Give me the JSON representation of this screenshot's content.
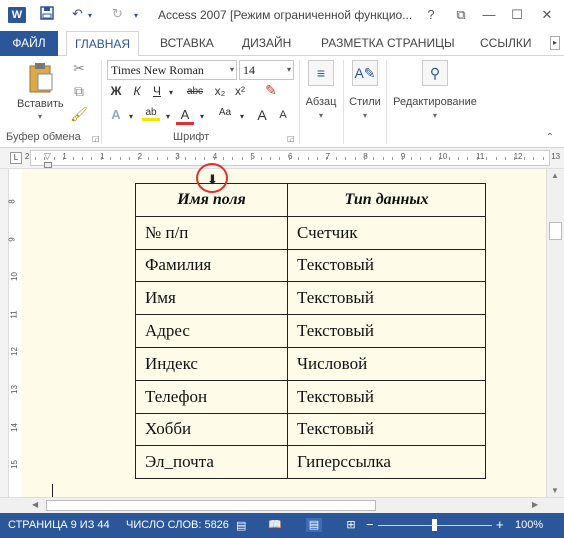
{
  "titlebar": {
    "title": "Access 2007 [Режим ограниченной функцио...",
    "app_icon": "W",
    "help": "?",
    "restore": "⧉",
    "minimize": "—",
    "maximize": "☐",
    "close": "✕"
  },
  "tabs": {
    "file": "ФАЙЛ",
    "home": "ГЛАВНАЯ",
    "insert": "ВСТАВКА",
    "design": "ДИЗАЙН",
    "layout": "РАЗМЕТКА СТРАНИЦЫ",
    "references": "ССЫЛКИ"
  },
  "ribbon": {
    "clipboard": {
      "paste": "Вставить",
      "group": "Буфер обмена"
    },
    "font": {
      "name": "Times New Roman",
      "size": "14",
      "bold": "Ж",
      "italic": "К",
      "underline": "Ч",
      "strike": "abc",
      "subscript": "x₂",
      "superscript": "x²",
      "grow": "A",
      "shrink": "A",
      "case": "Aa",
      "group": "Шрифт"
    },
    "paragraph": {
      "label": "Абзац"
    },
    "styles": {
      "label": "Стили"
    },
    "editing": {
      "label": "Редактирование"
    }
  },
  "ruler": {
    "h_numbers": [
      "2",
      "1",
      "1",
      "2",
      "3",
      "4",
      "5",
      "6",
      "7",
      "8",
      "9",
      "10",
      "11",
      "12",
      "13"
    ],
    "v_numbers": [
      "8",
      "9",
      "10",
      "11",
      "12",
      "13",
      "14",
      "15"
    ]
  },
  "table": {
    "headers": [
      "Имя поля",
      "Тип данных"
    ],
    "rows": [
      [
        "№ п/п",
        "Счетчик"
      ],
      [
        "Фамилия",
        "Текстовый"
      ],
      [
        "Имя",
        "Текстовый"
      ],
      [
        "Адрес",
        "Текстовый"
      ],
      [
        "Индекс",
        "Числовой"
      ],
      [
        "Телефон",
        "Текстовый"
      ],
      [
        "Хобби",
        "Текстовый"
      ],
      [
        "Эл_почта",
        "Гиперссылка"
      ]
    ]
  },
  "column_marker": "⬇",
  "status": {
    "page": "СТРАНИЦА 9 ИЗ 44",
    "words": "ЧИСЛО СЛОВ: 5826",
    "zoom": "100%",
    "zoom_minus": "−",
    "zoom_plus": "+"
  },
  "colors": {
    "accent": "#2b579a",
    "document_bg": "#fefce8",
    "annotation": "#e03030"
  }
}
